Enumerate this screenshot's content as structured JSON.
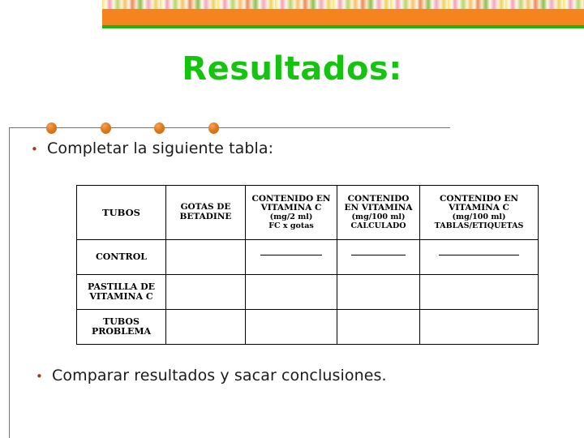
{
  "banner": {
    "photo_strip_label": "fruit-vegetable-photo-strip",
    "orange_color": "#f5841f",
    "green_stripe_color": "#1db511"
  },
  "title": "Resultados:",
  "title_color": "#14c40e",
  "divider": {
    "line_color": "#3f9c35",
    "dot_color": "#e07a1f",
    "dot_positions": [
      46,
      113,
      179,
      246
    ]
  },
  "bullets": {
    "first": {
      "mark": "•",
      "text": "Completar la siguiente tabla:"
    },
    "second": {
      "mark": "•",
      "text": "Comparar resultados y sacar conclusiones."
    }
  },
  "table": {
    "headers": [
      {
        "line1": "TUBOS",
        "line2": "",
        "line3": "",
        "line4": ""
      },
      {
        "line1": "GOTAS DE",
        "line2": "BETADINE",
        "line3": "",
        "line4": ""
      },
      {
        "line1": "CONTENIDO EN",
        "line2": "VITAMINA C",
        "line3": "(mg/2 ml)",
        "line4": "FC x gotas"
      },
      {
        "line1": "CONTENIDO",
        "line2": "EN VITAMINA",
        "line3": "(mg/100 ml)",
        "line4": "CALCULADO"
      },
      {
        "line1": "CONTENIDO EN",
        "line2": "VITAMINA C",
        "line3": "(mg/100 ml)",
        "line4": "TABLAS/ETIQUETAS"
      }
    ],
    "rows": [
      {
        "label_line1": "CONTROL",
        "label_line2": "",
        "gotas": "",
        "cont2ml": "",
        "cont100": "",
        "tablas": "",
        "has_blank_lines": true
      },
      {
        "label_line1": "PASTILLA DE",
        "label_line2": "VITAMINA C",
        "gotas": "",
        "cont2ml": "",
        "cont100": "",
        "tablas": "",
        "has_blank_lines": false
      },
      {
        "label_line1": "TUBOS",
        "label_line2": "PROBLEMA",
        "gotas": "",
        "cont2ml": "",
        "cont100": "",
        "tablas": "",
        "has_blank_lines": false
      }
    ]
  }
}
